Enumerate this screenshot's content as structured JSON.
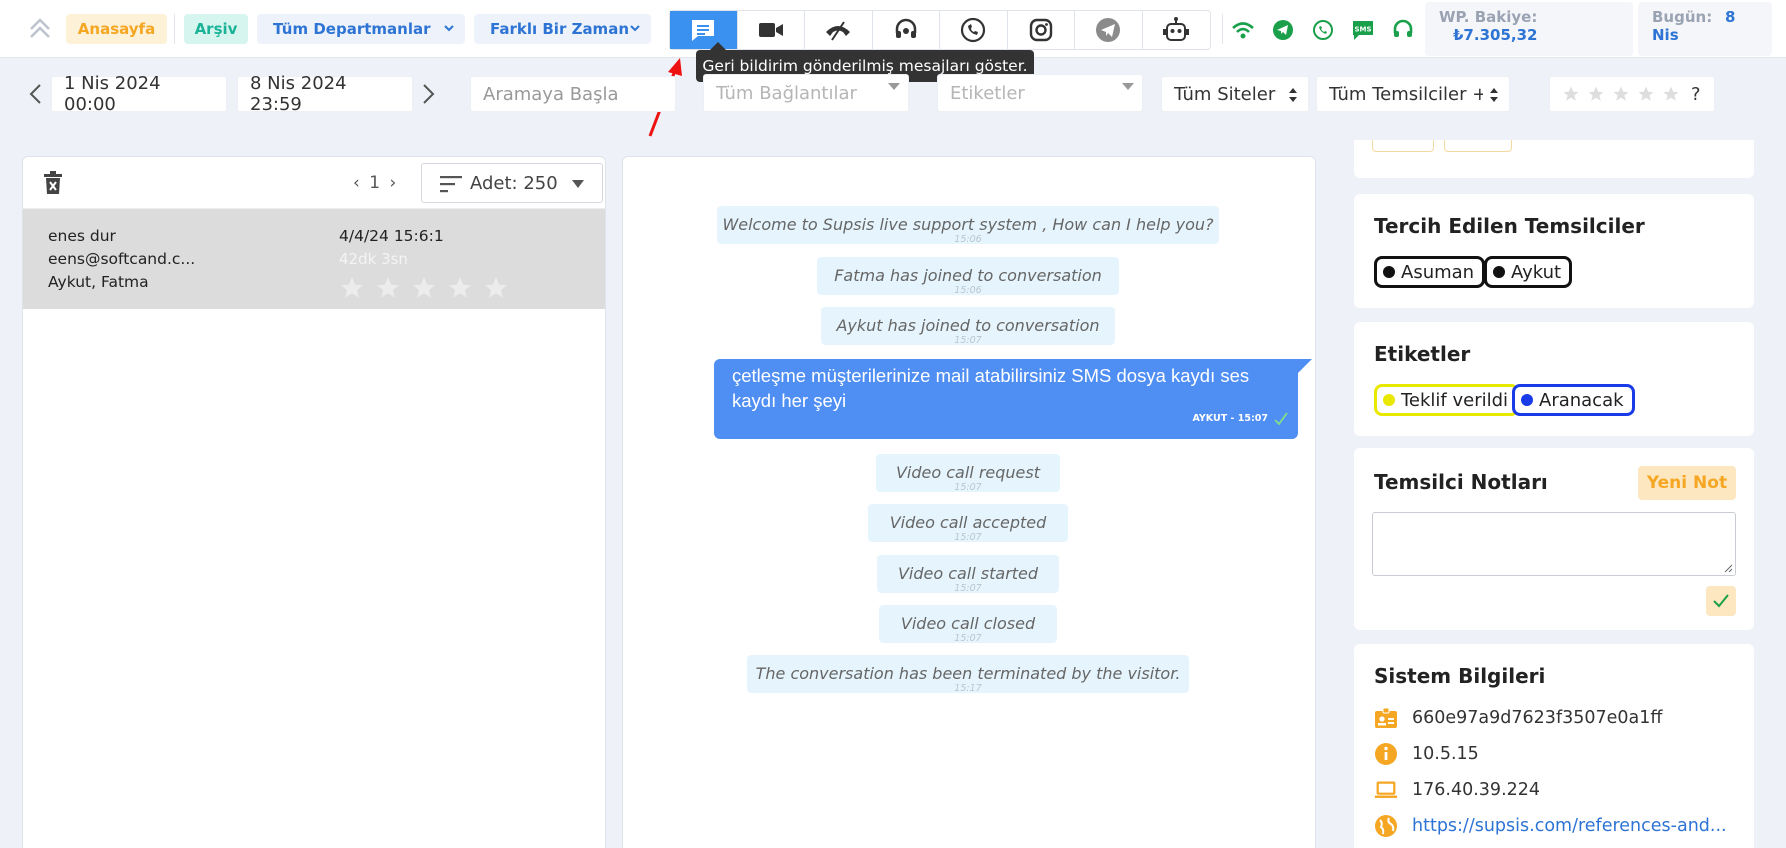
{
  "topbar": {
    "home_label": "Anasayfa",
    "archive_label": "Arşiv",
    "department_select": "Tüm Departmanlar",
    "time_select": "Farklı Bir Zaman",
    "channels": [
      "messages-icon",
      "video-icon",
      "phone-hangup-icon",
      "headset-icon",
      "whatsapp-icon",
      "instagram-icon",
      "telegram-icon",
      "bot-icon"
    ],
    "wp_balance_label": "WP. Bakiye:",
    "wp_balance_value": "₺7.305,32",
    "today_label": "Bugün:",
    "today_value_day": "8",
    "today_value_month": "Nis",
    "tooltip": "Geri bildirim gönderilmiş mesajları göster."
  },
  "filters": {
    "date_start": "1 Nis 2024 00:00",
    "date_end": "8 Nis 2024 23:59",
    "search_placeholder": "Aramaya Başla",
    "connections_placeholder": "Tüm Bağlantılar",
    "tags_placeholder": "Etiketler",
    "sites_select": "Tüm Siteler",
    "agents_select": "Tüm Temsilciler + (",
    "rating_help": "?"
  },
  "list": {
    "page": "1",
    "count_label": "Adet: 250",
    "items": [
      {
        "name": "enes dur",
        "email": "eens@softcand.c...",
        "agents": "Aykut, Fatma",
        "date": "4/4/24 15:6:1",
        "duration": "42dk 3sn"
      }
    ]
  },
  "chat": {
    "system_messages": [
      {
        "text": "Welcome to Supsis live support system , How can I help you?",
        "time": "15:06"
      },
      {
        "text": "Fatma has joined to conversation",
        "time": "15:06"
      },
      {
        "text": "Aykut has joined to conversation",
        "time": "15:07"
      },
      {
        "text": "Video call request",
        "time": "15:07"
      },
      {
        "text": "Video call accepted",
        "time": "15:07"
      },
      {
        "text": "Video call started",
        "time": "15:07"
      },
      {
        "text": "Video call closed",
        "time": "15:07"
      },
      {
        "text": "The conversation has been terminated by the visitor.",
        "time": "15:17"
      }
    ],
    "agent_message": {
      "line1": "çetleşme müşterilerinize mail atabilirsiniz SMS dosya kaydı ses",
      "line2": "kaydı her şeyi",
      "meta": "AYKUT - 15:07"
    }
  },
  "right": {
    "preferred_title": "Tercih Edilen Temsilciler",
    "preferred_agents": [
      "Asuman",
      "Aykut"
    ],
    "tags_title": "Etiketler",
    "tags": [
      {
        "label": "Teklif verildi",
        "color": "#e8e800"
      },
      {
        "label": "Aranacak",
        "color": "#1a3be8"
      }
    ],
    "notes_title": "Temsilci Notları",
    "new_note_label": "Yeni Not",
    "system_title": "Sistem Bilgileri",
    "system_info": {
      "id": "660e97a9d7623f3507e0a1ff",
      "version": "10.5.15",
      "ip": "176.40.39.224",
      "url": "https://supsis.com/references-and..."
    }
  },
  "colors": {
    "primary_blue": "#3b91ef",
    "orange": "#f5a623",
    "green": "#1aa04a"
  }
}
